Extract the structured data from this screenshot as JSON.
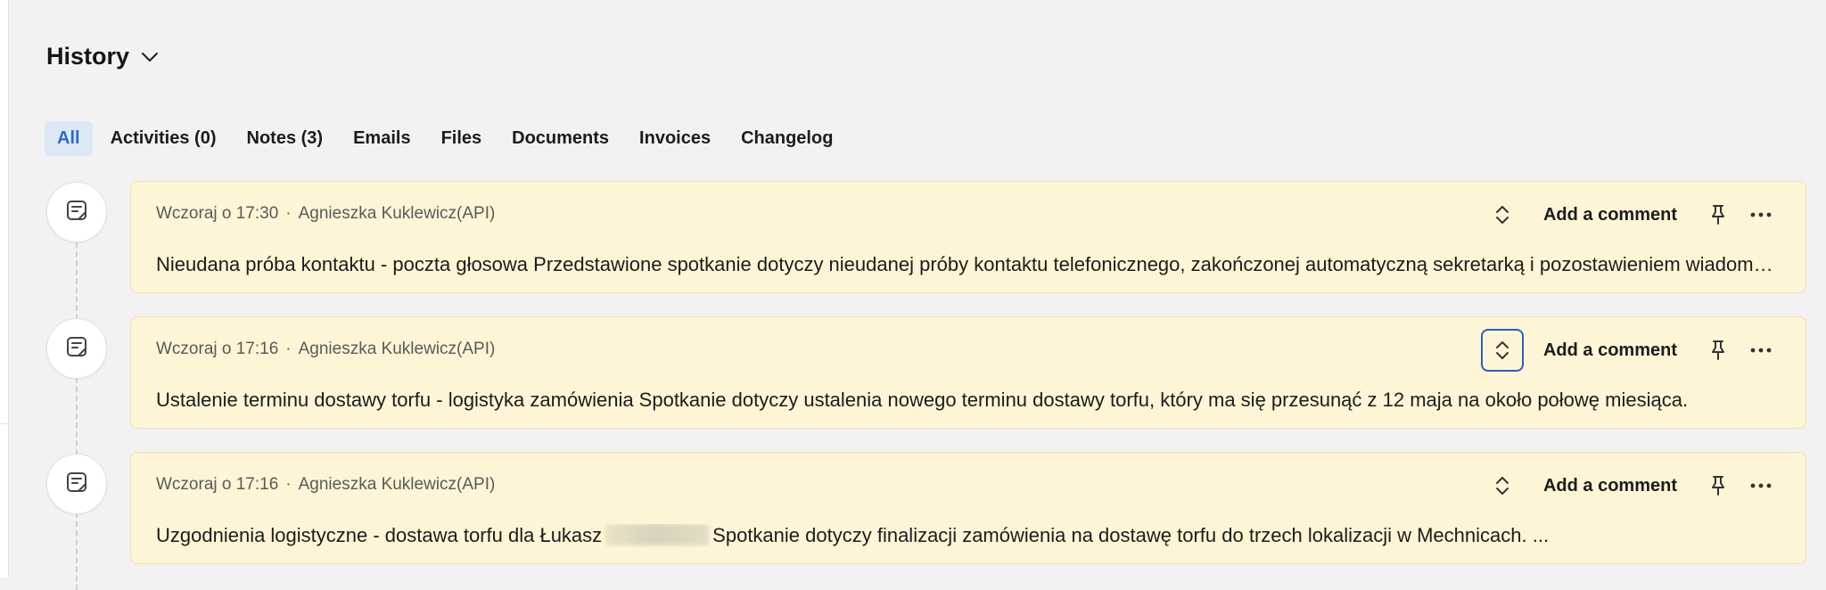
{
  "history": {
    "title": "History",
    "tabs": [
      {
        "label": "All",
        "active": true
      },
      {
        "label": "Activities (0)",
        "active": false
      },
      {
        "label": "Notes (3)",
        "active": false
      },
      {
        "label": "Emails",
        "active": false
      },
      {
        "label": "Files",
        "active": false
      },
      {
        "label": "Documents",
        "active": false
      },
      {
        "label": "Invoices",
        "active": false
      },
      {
        "label": "Changelog",
        "active": false
      }
    ],
    "entries": [
      {
        "time": "Wczoraj o 17:30",
        "separator": "·",
        "author": "Agnieszka Kuklewicz(API)",
        "text": "Nieudana próba kontaktu - poczta głosowa Przedstawione spotkanie dotyczy nieudanej próby kontaktu telefonicznego, zakończonej automatyczną sekretarką i pozostawieniem wiadomości.",
        "comment_label": "Add a comment",
        "icon": "note-icon"
      },
      {
        "time": "Wczoraj o 17:16",
        "separator": "·",
        "author": "Agnieszka Kuklewicz(API)",
        "text": "Ustalenie terminu dostawy torfu - logistyka zamówienia Spotkanie dotyczy ustalenia nowego terminu dostawy torfu, który ma się przesunąć z 12 maja na około połowę miesiąca.",
        "comment_label": "Add a comment",
        "icon": "note-icon"
      },
      {
        "time": "Wczoraj o 17:16",
        "separator": "·",
        "author": "Agnieszka Kuklewicz(API)",
        "text_before": "Uzgodnienia logistyczne - dostawa torfu dla Łukasz",
        "text_after": "Spotkanie dotyczy finalizacji zamówienia na dostawę torfu do trzech lokalizacji w Mechnicach. ...",
        "comment_label": "Add a comment",
        "icon": "note-icon"
      }
    ]
  },
  "colors": {
    "card_bg": "#fdf5d6",
    "active_tab_bg": "#dde8f6",
    "active_tab_text": "#2d6bc4",
    "focus_ring": "#2f5fb3"
  }
}
